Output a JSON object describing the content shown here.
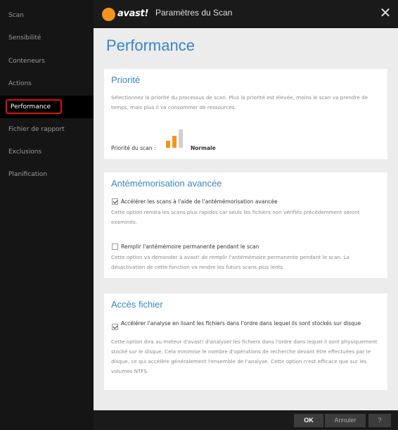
{
  "window": {
    "brand": "avast!",
    "title": "Paramètres du Scan",
    "close_icon": "close-icon"
  },
  "sidebar": {
    "items": [
      {
        "label": "Scan"
      },
      {
        "label": "Sensibilité"
      },
      {
        "label": "Conteneurs"
      },
      {
        "label": "Actions"
      },
      {
        "label": "Performance",
        "active": true
      },
      {
        "label": "Fichier de rapport"
      },
      {
        "label": "Exclusions"
      },
      {
        "label": "Planification"
      }
    ]
  },
  "main": {
    "title": "Performance",
    "priority": {
      "heading": "Priorité",
      "description": "Sélectionnez la priorité du processus de scan. Plus la priorité est élevée, moins le scan va prendre de temps, mais plus il va consommer de ressources.",
      "label": "Priorité du scan :",
      "value": "Normale",
      "level": 2,
      "levels": 3
    },
    "caching": {
      "heading": "Antémémorisation avancée",
      "option1": {
        "label": "Accélérer les scans à l'aide de l'antémémorisation avancée",
        "checked": true,
        "description": "Cette option rendra les scans plus rapides car seuls les fichiers non vérifiés précédemment seront examinés."
      },
      "option2": {
        "label": "Remplir l'antémémoire permanente pendant le scan",
        "checked": false,
        "description": "Cette option va demander à avast! de remplir l'antémémoire permanente pendant le scan. La désactivation de cette fonction va rendre les futurs scans plus lents."
      }
    },
    "file_access": {
      "heading": "Accès fichier",
      "option": {
        "label": "Accélérer l'analyse en lisant les fichiers dans l'ordre dans lequel ils sont stockés sur disque",
        "checked": true,
        "description": "Cette option dira au moteur d'avast! d'analyser les fichiers dans l'ordre dans lequel il sont physiquement stocké sur le disque. Cela minimise le nombre d'opérations de recherche devant être effectuées par le disque, ce qui accélère généralement l'ensemble de l'analyse. Cette option n'est efficace que sur les volumes NTFS."
      }
    }
  },
  "footer": {
    "ok_label": "OK",
    "cancel_label": "Annuler",
    "help_label": "?"
  },
  "colors": {
    "accent": "#3a86c5",
    "brand_orange": "#f7941d",
    "active_bar": "#f7941d",
    "inactive_bar": "#d0d0d0",
    "highlight": "#e01010"
  }
}
